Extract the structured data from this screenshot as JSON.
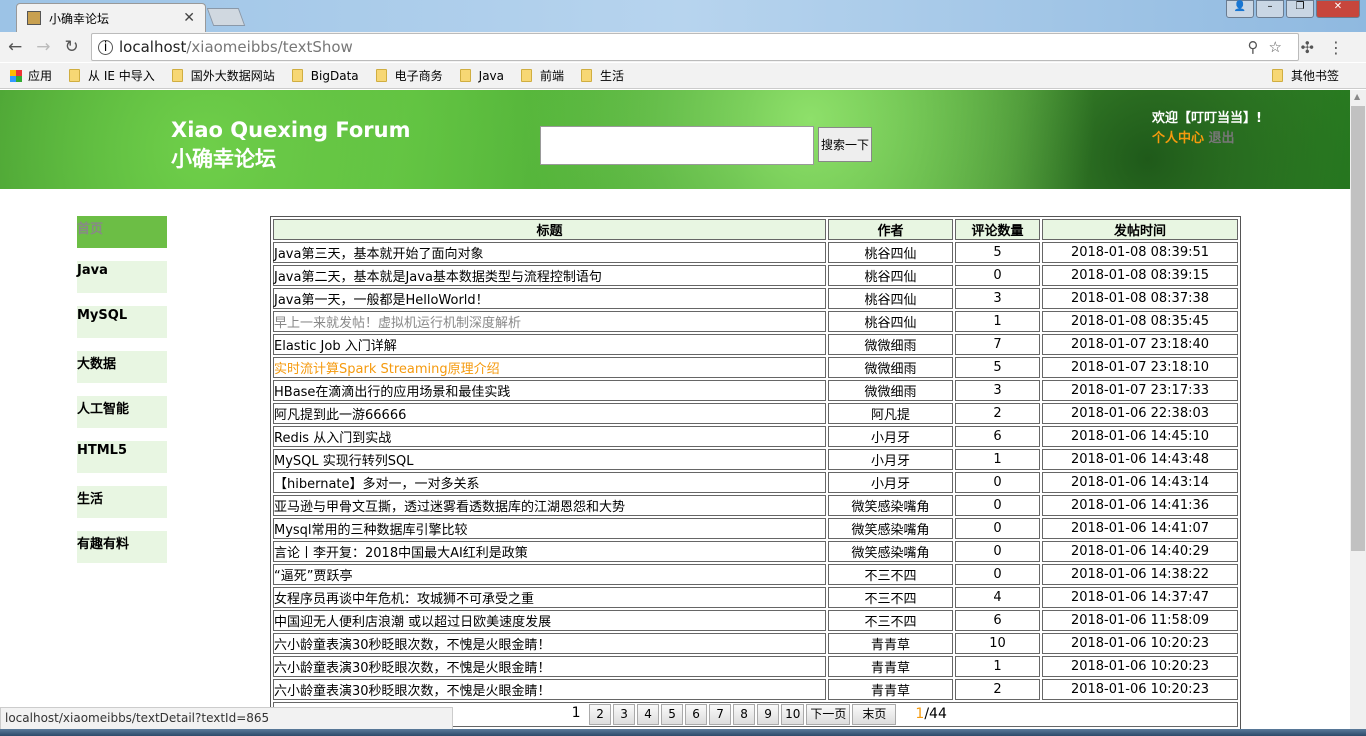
{
  "browser": {
    "tab_title": "小确幸论坛",
    "url_host": "localhost",
    "url_path": "/xiaomeibbs/textShow",
    "bookmarks": [
      "应用",
      "从 IE 中导入",
      "国外大数据网站",
      "BigData",
      "电子商务",
      "Java",
      "前端",
      "生活"
    ],
    "other_bookmarks": "其他书签",
    "status_url": "localhost/xiaomeibbs/textDetail?textId=865"
  },
  "header": {
    "title_en": "Xiao Quexing Forum",
    "title_cn": "小确幸论坛",
    "search_placeholder": "",
    "search_button": "搜索一下",
    "welcome": "欢迎【叮叮当当】!",
    "profile_link": "个人中心",
    "logout_link": "退出"
  },
  "sidebar": {
    "items": [
      "首页",
      "Java",
      "MySQL",
      "大数据",
      "人工智能",
      "HTML5",
      "生活",
      "有趣有料"
    ]
  },
  "table": {
    "headers": [
      "标题",
      "作者",
      "评论数量",
      "发帖时间"
    ],
    "rows": [
      [
        "Java第三天，基本就开始了面向对象",
        "桃谷四仙",
        "5",
        "2018-01-08 08:39:51"
      ],
      [
        "Java第二天，基本就是Java基本数据类型与流程控制语句",
        "桃谷四仙",
        "0",
        "2018-01-08 08:39:15"
      ],
      [
        "Java第一天，一般都是HelloWorld！",
        "桃谷四仙",
        "3",
        "2018-01-08 08:37:38"
      ],
      [
        "早上一来就发帖！虚拟机运行机制深度解析",
        "桃谷四仙",
        "1",
        "2018-01-08 08:35:45"
      ],
      [
        "Elastic Job 入门详解",
        "微微细雨",
        "7",
        "2018-01-07 23:18:40"
      ],
      [
        "实时流计算Spark Streaming原理介绍",
        "微微细雨",
        "5",
        "2018-01-07 23:18:10"
      ],
      [
        "HBase在滴滴出行的应用场景和最佳实践",
        "微微细雨",
        "3",
        "2018-01-07 23:17:33"
      ],
      [
        "阿凡提到此一游66666",
        "阿凡提",
        "2",
        "2018-01-06 22:38:03"
      ],
      [
        "Redis 从入门到实战",
        "小月牙",
        "6",
        "2018-01-06 14:45:10"
      ],
      [
        "MySQL 实现行转列SQL",
        "小月牙",
        "1",
        "2018-01-06 14:43:48"
      ],
      [
        "【hibernate】多对一，一对多关系",
        "小月牙",
        "0",
        "2018-01-06 14:43:14"
      ],
      [
        "亚马逊与甲骨文互撕，透过迷雾看透数据库的江湖恩怨和大势",
        "微笑感染嘴角",
        "0",
        "2018-01-06 14:41:36"
      ],
      [
        "Mysql常用的三种数据库引擎比较",
        "微笑感染嘴角",
        "0",
        "2018-01-06 14:41:07"
      ],
      [
        "言论丨李开复：2018中国最大AI红利是政策",
        "微笑感染嘴角",
        "0",
        "2018-01-06 14:40:29"
      ],
      [
        "“逼死”贾跃亭",
        "不三不四",
        "0",
        "2018-01-06 14:38:22"
      ],
      [
        "女程序员再谈中年危机：攻城狮不可承受之重",
        "不三不四",
        "4",
        "2018-01-06 14:37:47"
      ],
      [
        "中国迎无人便利店浪潮 或以超过日欧美速度发展",
        "不三不四",
        "6",
        "2018-01-06 11:58:09"
      ],
      [
        "六小龄童表演30秒眨眼次数，不愧是火眼金睛！",
        "青青草",
        "10",
        "2018-01-06 10:20:23"
      ],
      [
        "六小龄童表演30秒眨眼次数，不愧是火眼金睛！",
        "青青草",
        "1",
        "2018-01-06 10:20:23"
      ],
      [
        "六小龄童表演30秒眨眼次数，不愧是火眼金睛！",
        "青青草",
        "2",
        "2018-01-06 10:20:23"
      ]
    ],
    "visited_row_color": "#888888",
    "hover_row_color": "#f59a0e"
  },
  "pager": {
    "current": "1",
    "pages": [
      "2",
      "3",
      "4",
      "5",
      "6",
      "7",
      "8",
      "9",
      "10"
    ],
    "next": "下一页",
    "last": "末页",
    "page_current": "1",
    "page_total": "/44"
  }
}
